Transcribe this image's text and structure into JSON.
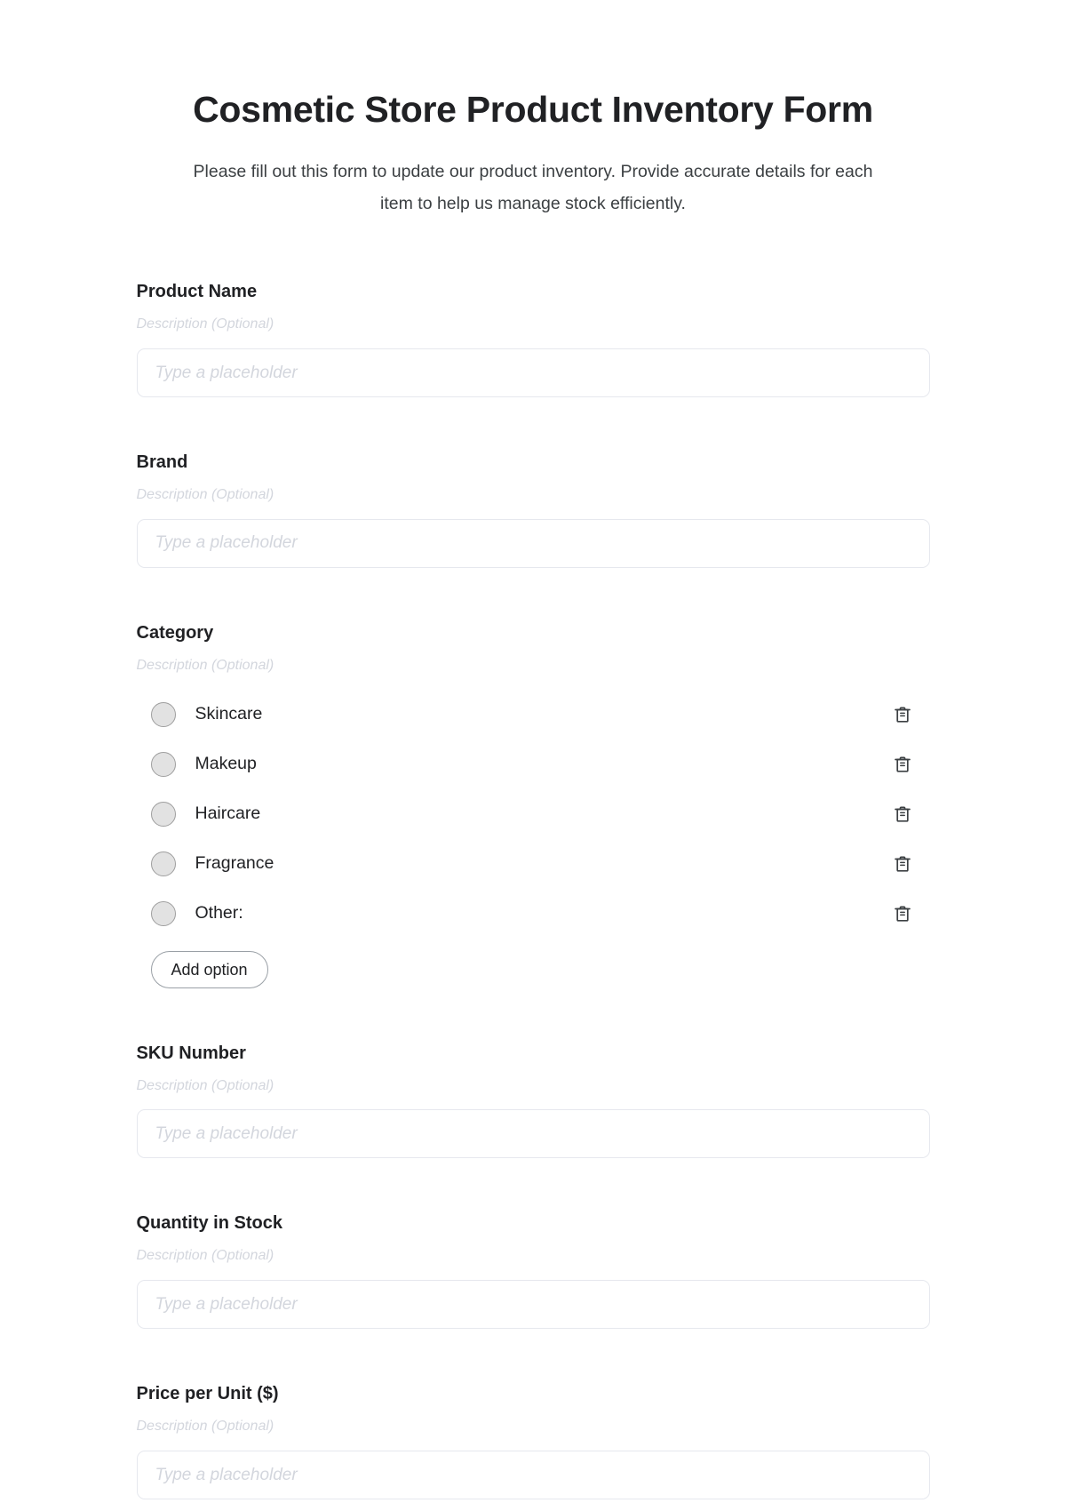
{
  "header": {
    "title": "Cosmetic Store Product Inventory Form",
    "subtitle": "Please fill out this form to update our product inventory. Provide accurate details for each item to help us manage stock efficiently."
  },
  "common": {
    "description_label": "Description (Optional)",
    "input_placeholder": "Type a placeholder",
    "add_option_label": "Add option",
    "delete_icon": "trash-icon",
    "radio_icon": "radio-circle-icon"
  },
  "fields": [
    {
      "label": "Product Name",
      "description": "Description (Optional)",
      "type": "text",
      "value": "",
      "placeholder": "Type a placeholder"
    },
    {
      "label": "Brand",
      "description": "Description (Optional)",
      "type": "text",
      "value": "",
      "placeholder": "Type a placeholder"
    },
    {
      "label": "Category",
      "description": "Description (Optional)",
      "type": "radio",
      "options": [
        {
          "label": "Skincare"
        },
        {
          "label": "Makeup"
        },
        {
          "label": "Haircare"
        },
        {
          "label": "Fragrance"
        },
        {
          "label": "Other:"
        }
      ],
      "add_option_label": "Add option"
    },
    {
      "label": "SKU Number",
      "description": "Description (Optional)",
      "type": "text",
      "value": "",
      "placeholder": "Type a placeholder"
    },
    {
      "label": "Quantity in Stock",
      "description": "Description (Optional)",
      "type": "text",
      "value": "",
      "placeholder": "Type a placeholder"
    },
    {
      "label": "Price per Unit ($)",
      "description": "Description (Optional)",
      "type": "text",
      "value": "",
      "placeholder": "Type a placeholder"
    }
  ],
  "colors": {
    "text_primary": "#202124",
    "text_secondary": "#3c4043",
    "placeholder": "#d3d6dd",
    "input_border": "#e6e8ee",
    "radio_fill": "#e2e2e2",
    "radio_border": "#9e9e9e",
    "icon": "#3c4043",
    "background": "#ffffff"
  }
}
